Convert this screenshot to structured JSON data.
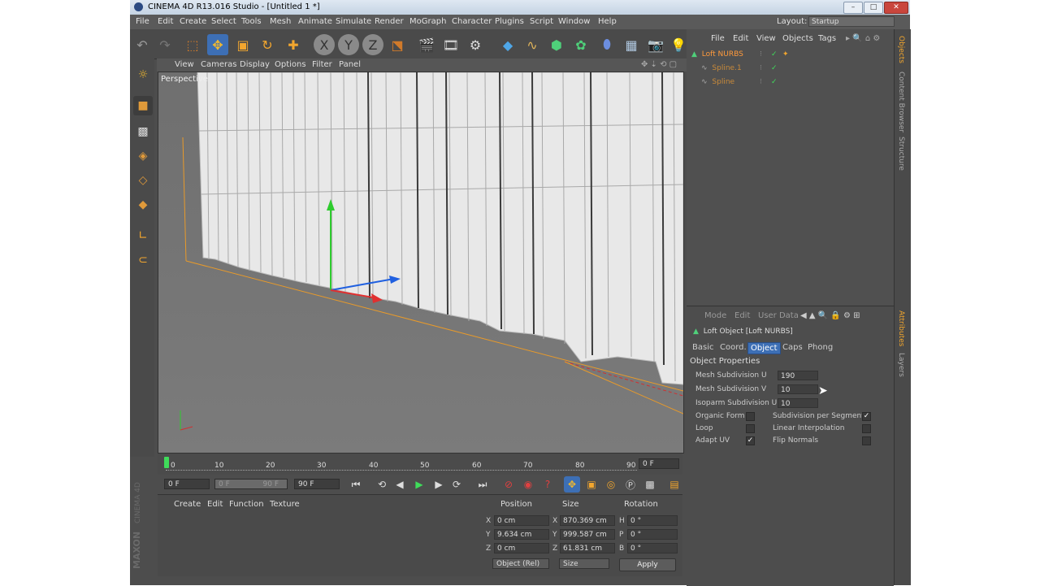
{
  "window": {
    "title": "CINEMA 4D R13.016 Studio - [Untitled 1 *]",
    "min": "–",
    "max": "□",
    "close": "✕"
  },
  "menubar": [
    "File",
    "Edit",
    "Create",
    "Select",
    "Tools",
    "Mesh",
    "Animate",
    "Simulate",
    "Render",
    "MoGraph",
    "Character",
    "Plugins",
    "Script",
    "Window",
    "Help"
  ],
  "layout": {
    "label": "Layout:",
    "value": "Startup"
  },
  "viewport": {
    "menu": [
      "View",
      "Cameras",
      "Display",
      "Options",
      "Filter",
      "Panel"
    ],
    "label": "Perspective"
  },
  "timeline": {
    "ticks": [
      "0",
      "10",
      "20",
      "30",
      "40",
      "50",
      "60",
      "70",
      "80",
      "90"
    ],
    "current": "0 F"
  },
  "transport": {
    "start": "0 F",
    "min": "0 F",
    "max": "90 F",
    "end": "90 F"
  },
  "material_manager": {
    "menu": [
      "Create",
      "Edit",
      "Function",
      "Texture"
    ]
  },
  "coords": {
    "headers": [
      "Position",
      "Size",
      "Rotation"
    ],
    "rows": [
      {
        "axis": "X",
        "pos": "0 cm",
        "saxis": "X",
        "size": "870.369 cm",
        "raxis": "H",
        "rot": "0 °"
      },
      {
        "axis": "Y",
        "pos": "9.634 cm",
        "saxis": "Y",
        "size": "999.587 cm",
        "raxis": "P",
        "rot": "0 °"
      },
      {
        "axis": "Z",
        "pos": "0 cm",
        "saxis": "Z",
        "size": "61.831 cm",
        "raxis": "B",
        "rot": "0 °"
      }
    ],
    "mode": "Object (Rel)",
    "size_mode": "Size",
    "apply": "Apply"
  },
  "object_manager": {
    "menu": [
      "File",
      "Edit",
      "View",
      "Objects",
      "Tags"
    ],
    "objects": [
      {
        "name": "Loft NURBS",
        "color": "#ff9a3c"
      },
      {
        "name": "Spline.1",
        "color": "#c98a3a"
      },
      {
        "name": "Spline",
        "color": "#c98a3a"
      }
    ]
  },
  "attributes": {
    "menu": [
      "Mode",
      "Edit",
      "User Data"
    ],
    "object_title": "Loft Object [Loft NURBS]",
    "tabs": [
      "Basic",
      "Coord.",
      "Object",
      "Caps",
      "Phong"
    ],
    "active_tab": "Object",
    "section": "Object Properties",
    "fields": [
      {
        "label": "Mesh Subdivision U",
        "value": "190"
      },
      {
        "label": "Mesh Subdivision V",
        "value": "10"
      },
      {
        "label": "Isoparm Subdivision U",
        "value": "10"
      }
    ],
    "checks_left": [
      {
        "label": "Organic Form",
        "checked": ""
      },
      {
        "label": "Loop",
        "checked": ""
      },
      {
        "label": "Adapt UV",
        "checked": "✓"
      }
    ],
    "checks_right": [
      {
        "label": "Subdivision per Segment",
        "checked": "✓"
      },
      {
        "label": "Linear Interpolation",
        "checked": ""
      },
      {
        "label": "Flip Normals",
        "checked": ""
      }
    ]
  },
  "side_tabs": [
    "Objects",
    "Content Browser",
    "Structure",
    "Attributes",
    "Layers"
  ],
  "branding": {
    "maxon": "MAXON",
    "cinema": "CINEMA 4D"
  },
  "colors": {
    "accent_blue": "#3d6fb5",
    "play_green": "#3fdc5a",
    "ui_bg": "#4d4d4d"
  }
}
